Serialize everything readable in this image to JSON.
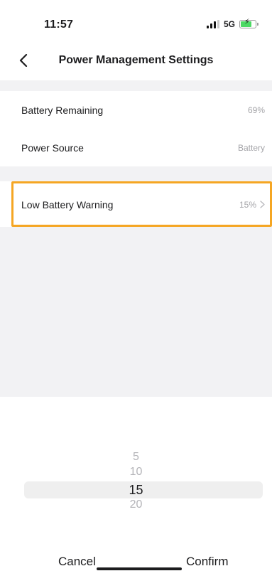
{
  "status_bar": {
    "time": "11:57",
    "network": "5G",
    "icons": [
      "signal-icon",
      "battery-charging-icon"
    ]
  },
  "header": {
    "title": "Power Management Settings",
    "back_icon": "chevron-left-icon"
  },
  "settings": {
    "rows": [
      {
        "label": "Battery Remaining",
        "value": "69%"
      },
      {
        "label": "Power Source",
        "value": "Battery"
      },
      {
        "label": "Low Battery Warning",
        "value": "15%",
        "icon": "chevron-right-icon"
      }
    ]
  },
  "picker": {
    "options": [
      "5",
      "10",
      "15",
      "20"
    ],
    "selected": "15",
    "cancel_label": "Cancel",
    "confirm_label": "Confirm"
  },
  "colors": {
    "highlight": "#f5a623",
    "background": "#f2f2f4",
    "secondary_text": "#a4a4a8"
  }
}
